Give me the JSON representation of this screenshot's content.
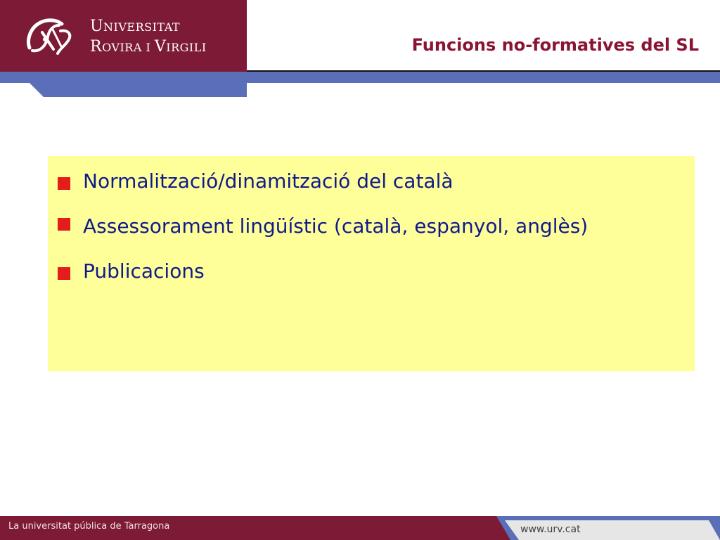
{
  "header": {
    "logo": {
      "line1_initial": "U",
      "line1_rest": "NIVERSITAT",
      "line2_initial": "R",
      "line2_rest": "OVIRA I ",
      "line2_initial2": "V",
      "line2_rest2": "IRGILI"
    },
    "title": "Funcions no-formatives del SL"
  },
  "content": {
    "bullets": [
      "Normalització/dinamització del català",
      "Assessorament lingüístic (català, espanyol, anglès)",
      "Publicacions"
    ]
  },
  "footer": {
    "tagline": "La universitat pública de Tarragona",
    "url": "www.urv.cat"
  },
  "colors": {
    "brand": "#7d1a36",
    "band": "#5b6fb8",
    "title": "#8b1433",
    "box": "#ffff99",
    "text": "#101a8a",
    "bullet": "#e41c1c"
  }
}
